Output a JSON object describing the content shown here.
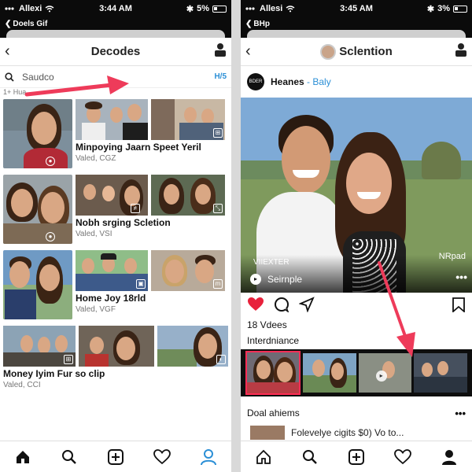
{
  "left": {
    "status": {
      "carrier": "Allexi",
      "time": "3:44 AM",
      "battery": "5%"
    },
    "back_label": "Doels Gif",
    "nav_title": "Decodes",
    "search": {
      "placeholder": "Saudco",
      "count": "H/5"
    },
    "section_tag": "1+ Hua",
    "albums": [
      {
        "title": "Minpoying Jaarn Speet Yeril",
        "subtitle": "Valed, CGZ"
      },
      {
        "title": "Nobh srging Scletion",
        "subtitle": "Valed, VSI"
      },
      {
        "title": "Home Joy 18rld",
        "subtitle": "Valed, VGF"
      },
      {
        "title": "Money Iyim Fur so clip",
        "subtitle": "Valed, CCI"
      }
    ],
    "tabs": [
      "home-icon",
      "search-icon",
      "add-icon",
      "heart-icon",
      "profile-icon"
    ],
    "active_tab": "profile-icon"
  },
  "right": {
    "status": {
      "carrier": "Allesi",
      "time": "3:45 AM",
      "battery": "3%"
    },
    "back_label": "BHp",
    "nav_title": "Sclention",
    "post": {
      "logo_text": "BDER",
      "account": "Heanes",
      "account_suffix": "- Baly",
      "overlay_label": "VIIEXTER",
      "overlay_sub": "Seirnple",
      "overlay_badge": "NRpad",
      "likes": "18 Vdees",
      "section": "Interdniance",
      "section2": "Doal ahiems",
      "caption": "Folevelye cigits $0) Vo to..."
    },
    "tabs": [
      "home-icon",
      "search-icon",
      "add-icon",
      "heart-icon",
      "profile-icon"
    ]
  },
  "colors": {
    "accent": "#2b8fd6",
    "highlight": "#ff2d55",
    "like": "#e8213b"
  }
}
